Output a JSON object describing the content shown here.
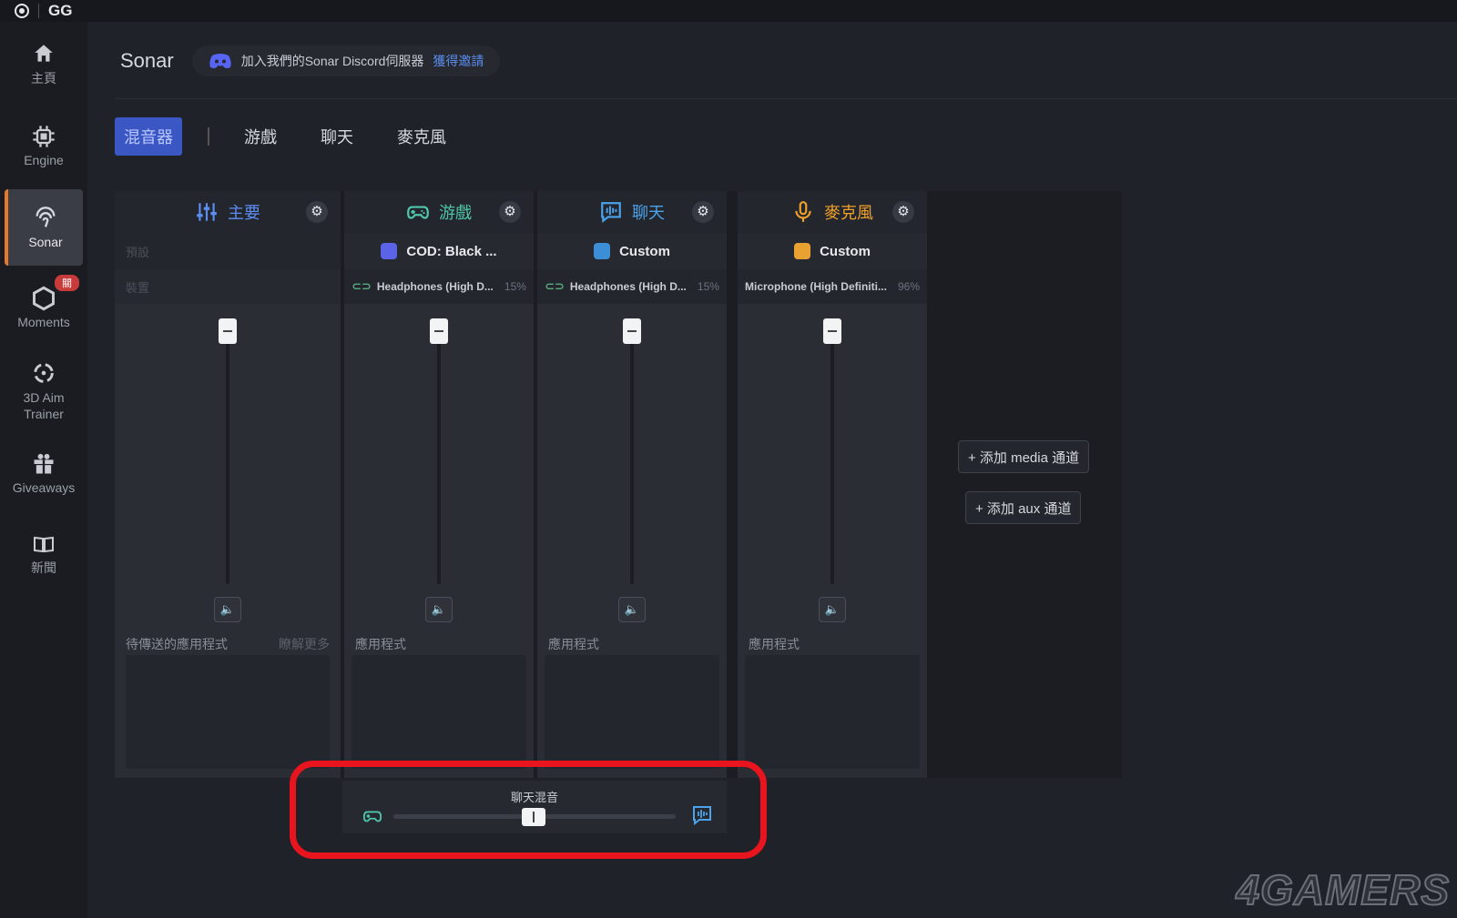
{
  "topbar": {
    "brand": "GG"
  },
  "sidebar": {
    "items": [
      {
        "label": "主頁",
        "icon": "home-icon"
      },
      {
        "label": "Engine",
        "icon": "chip-icon"
      },
      {
        "label": "Sonar",
        "icon": "sonar-icon",
        "active": true
      },
      {
        "label": "Moments",
        "icon": "hexagon-icon",
        "badge": "關"
      },
      {
        "label": "3D Aim\nTrainer",
        "icon": "crosshair-icon"
      },
      {
        "label": "Giveaways",
        "icon": "gift-icon"
      },
      {
        "label": "新聞",
        "icon": "book-icon"
      }
    ]
  },
  "header": {
    "title": "Sonar",
    "discord_text": "加入我們的Sonar Discord伺服器",
    "discord_link": "獲得邀請"
  },
  "tabs": [
    {
      "label": "混音器",
      "active": true
    },
    {
      "label": "游戲"
    },
    {
      "label": "聊天"
    },
    {
      "label": "麥克風"
    }
  ],
  "channels": {
    "main": {
      "title": "主要",
      "preset_label": "預設",
      "device_label": "裝置",
      "apps_label": "待傳送的應用程式",
      "more_label": "瞭解更多",
      "color": "#5c8df0"
    },
    "game": {
      "title": "游戲",
      "preset": "COD: Black ...",
      "device": "Headphones (High D...",
      "pct": "15%",
      "apps_label": "應用程式",
      "color": "#4fc7a8"
    },
    "chat": {
      "title": "聊天",
      "preset": "Custom",
      "device": "Headphones (High D...",
      "pct": "15%",
      "apps_label": "應用程式",
      "color": "#4ca3ec"
    },
    "mic": {
      "title": "麥克風",
      "preset": "Custom",
      "device": "Microphone (High Definiti...",
      "pct": "96%",
      "apps_label": "應用程式",
      "color": "#f0a12a"
    }
  },
  "add_media": "+ 添加 media 通道",
  "add_aux": "+ 添加 aux 通道",
  "chatmix": {
    "label": "聊天混音",
    "balance": 0.5
  },
  "watermark": "4GAMERS"
}
